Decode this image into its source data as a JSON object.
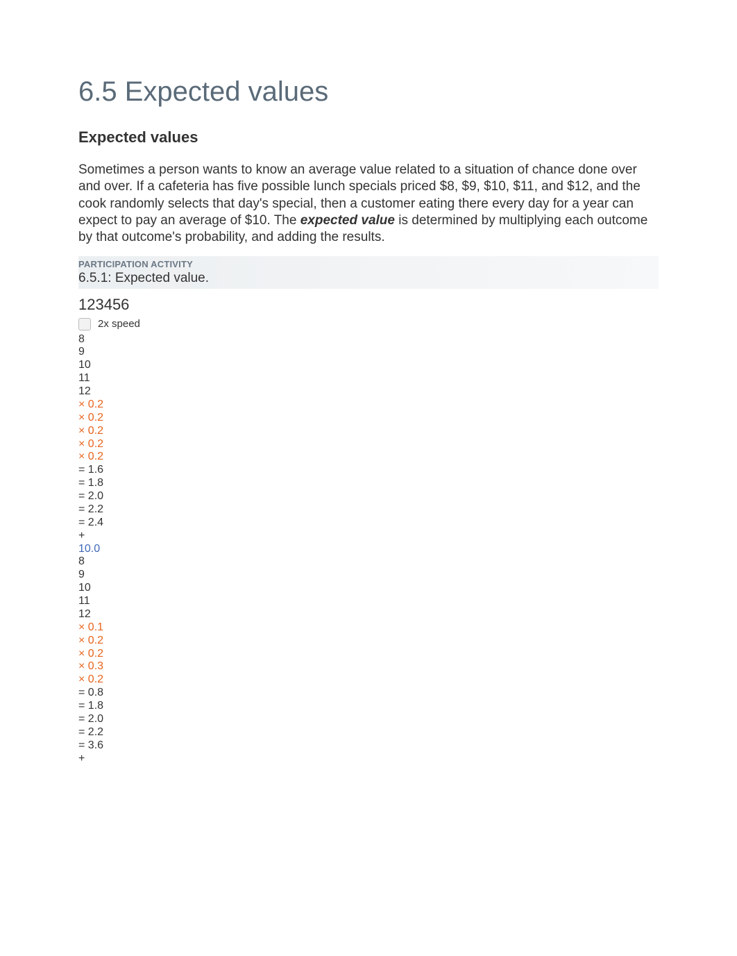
{
  "title": "6.5 Expected values",
  "subtitle": "Expected values",
  "paragraph": {
    "before_term": "Sometimes a person wants to know an average value related to a situation of chance done over and over. If a cafeteria has five possible lunch specials priced $8, $9, $10, $11, and $12, and the cook randomly selects that day's special, then a customer eating there every day for a year can expect to pay an average of $10. The ",
    "term": "expected value",
    "after_term": " is determined by multiplying each outcome by that outcome's probability, and adding the results."
  },
  "activity": {
    "label": "PARTICIPATION ACTIVITY",
    "title": "6.5.1: Expected value.",
    "steps": "123456",
    "speed_label": "2x speed"
  },
  "example1": {
    "outcomes": [
      "8",
      "9",
      "10",
      "11",
      "12"
    ],
    "probs": [
      "× 0.2",
      "× 0.2",
      "× 0.2",
      "× 0.2",
      "× 0.2"
    ],
    "products": [
      "= 1.6",
      "= 1.8",
      "= 2.0",
      "= 2.2",
      "= 2.4"
    ],
    "plus": "+",
    "total": "10.0"
  },
  "example2": {
    "outcomes": [
      "8",
      "9",
      "10",
      "11",
      "12"
    ],
    "probs": [
      "× 0.1",
      "× 0.2",
      "× 0.2",
      "× 0.3",
      "× 0.2"
    ],
    "products": [
      "= 0.8",
      "= 1.8",
      "= 2.0",
      "= 2.2",
      "= 3.6"
    ],
    "plus": "+"
  }
}
